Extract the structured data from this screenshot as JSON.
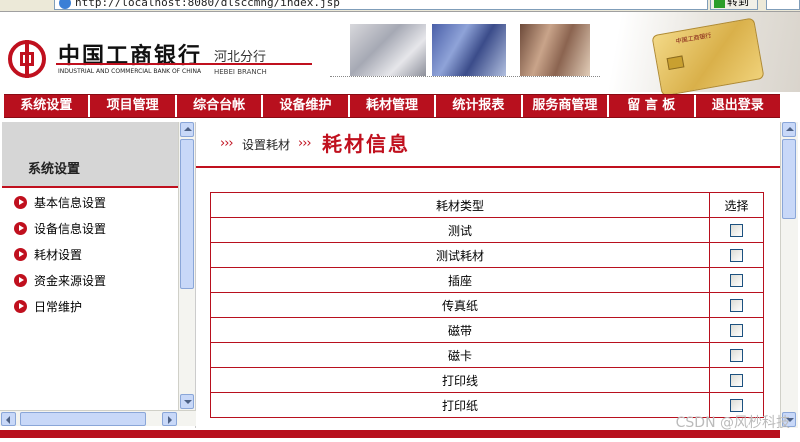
{
  "browser": {
    "address": "http://localhost:8080/dlsccmng/index.jsp",
    "go_label": "转到"
  },
  "header": {
    "bank_name_cn": "中国工商银行",
    "bank_name_en": "INDUSTRIAL AND COMMERCIAL BANK OF CHINA",
    "branch_cn": "河北分行",
    "branch_en": "HEBEI BRANCH"
  },
  "nav": {
    "items": [
      "系统设置",
      "项目管理",
      "综合台帐",
      "设备维护",
      "耗材管理",
      "统计报表",
      "服务商管理",
      "留 言 板",
      "退出登录"
    ]
  },
  "sidebar": {
    "title": "系统设置",
    "items": [
      "基本信息设置",
      "设备信息设置",
      "耗材设置",
      "资金来源设置",
      "日常维护"
    ]
  },
  "main": {
    "breadcrumb_chevron": "›››",
    "breadcrumb_sub": "设置耗材",
    "title": "耗材信息",
    "table": {
      "headers": [
        "耗材类型",
        "选择"
      ],
      "rows": [
        "测试",
        "测试耗材",
        "插座",
        "传真纸",
        "磁带",
        "磁卡",
        "打印线",
        "打印纸"
      ]
    }
  },
  "watermark": "CSDN @风杪科技"
}
